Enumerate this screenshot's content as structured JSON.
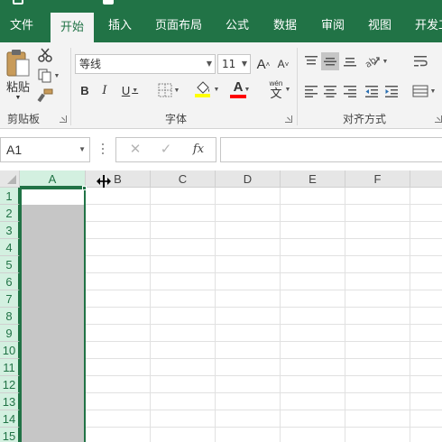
{
  "ribbon_tabs": [
    {
      "label": "文件",
      "active": false
    },
    {
      "label": "开始",
      "active": true
    },
    {
      "label": "插入",
      "active": false
    },
    {
      "label": "页面布局",
      "active": false
    },
    {
      "label": "公式",
      "active": false
    },
    {
      "label": "数据",
      "active": false
    },
    {
      "label": "审阅",
      "active": false
    },
    {
      "label": "视图",
      "active": false
    },
    {
      "label": "开发工",
      "active": false
    }
  ],
  "clipboard": {
    "paste_label": "粘贴",
    "group_label": "剪贴板"
  },
  "font": {
    "name": "等线",
    "size": "11",
    "grow_label": "A",
    "shrink_label": "A",
    "bold_label": "B",
    "italic_label": "I",
    "underline_label": "U",
    "font_color_label": "A",
    "phonetic_label": "wén",
    "phonetic_char": "文",
    "group_label": "字体",
    "fill_color": "#ffff00",
    "text_color": "#ff0000"
  },
  "alignment": {
    "group_label": "对齐方式"
  },
  "formula_bar": {
    "name_box": "A1",
    "fx_label": "fx",
    "formula": ""
  },
  "grid": {
    "columns": [
      "A",
      "B",
      "C",
      "D",
      "E",
      "F"
    ],
    "rows": [
      "1",
      "2",
      "3",
      "4",
      "5",
      "6",
      "7",
      "8",
      "9",
      "10",
      "11",
      "12",
      "13",
      "14",
      "15"
    ],
    "selected_column": "A",
    "active_cell": "A1"
  },
  "colors": {
    "accent": "#217346",
    "ribbon_bg": "#f3f3f3",
    "selection": "#c6c6c6"
  }
}
